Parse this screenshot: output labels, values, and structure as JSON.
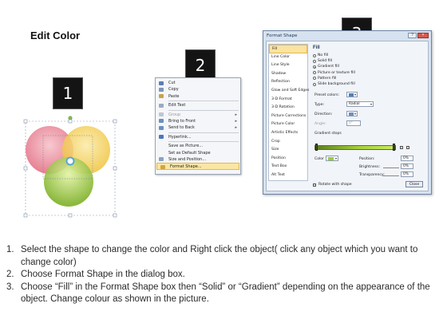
{
  "title": "Edit Color",
  "badges": [
    "1",
    "2",
    "3"
  ],
  "context_menu": {
    "items": [
      {
        "label": "Cut",
        "icon": "scissors-icon",
        "color": "#5d7fb3",
        "disabled": false
      },
      {
        "label": "Copy",
        "icon": "copy-icon",
        "color": "#7d95bd",
        "disabled": false
      },
      {
        "label": "Paste",
        "icon": "paste-icon",
        "color": "#c9a24a",
        "disabled": false
      },
      {
        "label": "Edit Text",
        "icon": "edit-text-icon",
        "color": "#9aaac2",
        "disabled": false
      },
      {
        "label": "Group",
        "icon": "group-icon",
        "color": "#bfc6d0",
        "disabled": true,
        "submenu": true
      },
      {
        "label": "Bring to Front",
        "icon": "bring-front-icon",
        "color": "#6a8fc0",
        "disabled": false,
        "submenu": true
      },
      {
        "label": "Send to Back",
        "icon": "send-back-icon",
        "color": "#6a8fc0",
        "disabled": false,
        "submenu": true
      },
      {
        "label": "Hyperlink...",
        "icon": "hyperlink-icon",
        "color": "#4c77b8",
        "disabled": false
      },
      {
        "label": "Save as Picture...",
        "icon": "",
        "color": "",
        "disabled": false
      },
      {
        "label": "Set as Default Shape",
        "icon": "",
        "color": "",
        "disabled": false
      },
      {
        "label": "Size and Position...",
        "icon": "size-position-icon",
        "color": "#8aa3c6",
        "disabled": false
      },
      {
        "label": "Format Shape...",
        "icon": "format-shape-icon",
        "color": "#d2a63f",
        "disabled": false
      }
    ]
  },
  "dialog": {
    "title": "Format Shape",
    "close_x": "×",
    "categories": [
      "Fill",
      "Line Color",
      "Line Style",
      "Shadow",
      "Reflection",
      "Glow and Soft Edges",
      "3-D Format",
      "3-D Rotation",
      "Picture Corrections",
      "Picture Color",
      "Artistic Effects",
      "Crop",
      "Size",
      "Position",
      "Text Box",
      "Alt Text"
    ],
    "pane_heading": "Fill",
    "fill_options": [
      "No fill",
      "Solid fill",
      "Gradient fill",
      "Picture or texture fill",
      "Pattern fill",
      "Slide background fill"
    ],
    "selected_fill": "Gradient fill",
    "preset_colors_label": "Preset colors:",
    "type_label": "Type:",
    "type_value": "Radial",
    "direction_label": "Direction:",
    "angle_label": "Angle:",
    "angle_value": "0°",
    "gradient_stops_label": "Gradient stops",
    "color_label": "Color",
    "position_label": "Position:",
    "position_value": "0%",
    "brightness_label": "Brightness:",
    "brightness_value": "0%",
    "transparency_label": "Transparency:",
    "transparency_value": "0%",
    "rotate_label": "Rotate with shape",
    "close_label": "Close"
  },
  "colors": {
    "venn_pink": "#e98a9a",
    "venn_yellow": "#f5d76a",
    "venn_green": "#9ccd3a",
    "venn_center": "#5aa6d6",
    "gradient_green": "#a6d13a"
  },
  "instructions": [
    {
      "num": "1.",
      "text": "Select the shape to change the color and Right click the object( click any object which you want to change color)"
    },
    {
      "num": "2.",
      "text": "Choose Format Shape in the dialog box."
    },
    {
      "num": "3.",
      "text": "Choose “Fill” in the Format Shape box then “Solid” or “Gradient” depending on the appearance of the object. Change colour as shown in the picture."
    }
  ]
}
